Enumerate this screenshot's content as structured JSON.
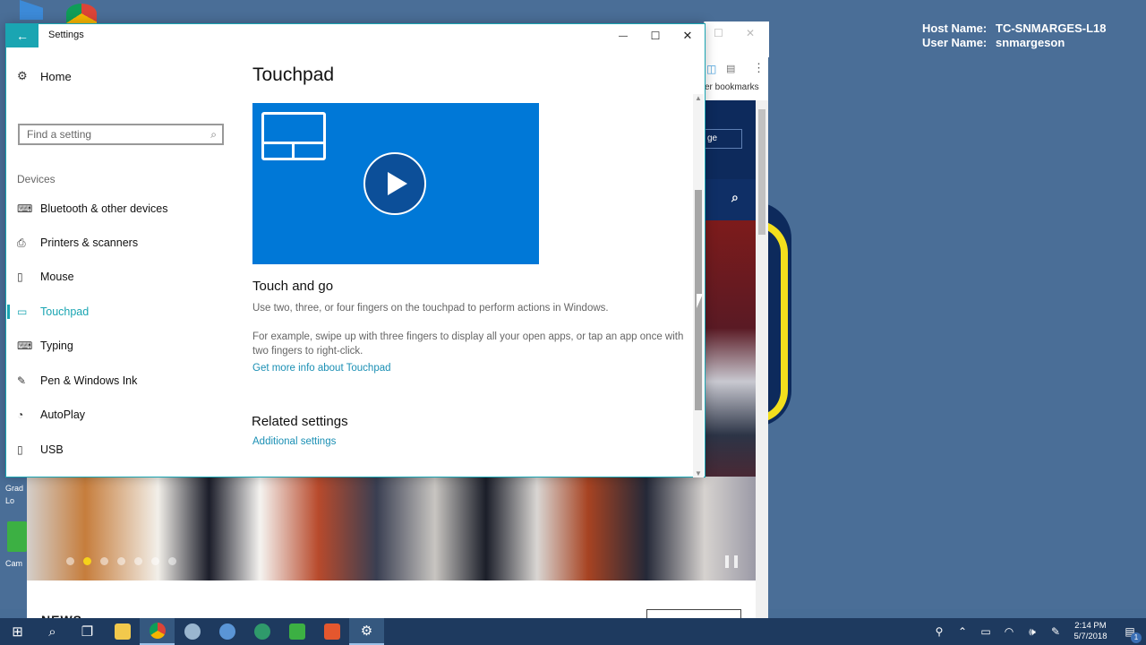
{
  "bginfo": {
    "host_key": "Host Name:",
    "host_value": "TC-SNMARGES-L18",
    "user_key": "User Name:",
    "user_value": "snmargeson"
  },
  "browser": {
    "bookmarks_text": "er bookmarks",
    "nav_button_text": "ge"
  },
  "desktop": {
    "icon_label_1": "Grad",
    "icon_label_2": "Lo",
    "icon_label_3": "Cam"
  },
  "below": {
    "news": "NEWS"
  },
  "settings": {
    "window_title": "Settings",
    "back_glyph": "←",
    "minimize_glyph": "—",
    "maximize_glyph": "☐",
    "close_glyph": "✕",
    "home_label": "Home",
    "search_placeholder": "Find a setting",
    "section_label": "Devices",
    "nav_items": [
      {
        "label": "Bluetooth & other devices",
        "icon": "keyboard-icon"
      },
      {
        "label": "Printers & scanners",
        "icon": "printer-icon"
      },
      {
        "label": "Mouse",
        "icon": "mouse-icon"
      },
      {
        "label": "Touchpad",
        "icon": "touchpad-icon",
        "active": true
      },
      {
        "label": "Typing",
        "icon": "keyboard-icon"
      },
      {
        "label": "Pen & Windows Ink",
        "icon": "pen-icon"
      },
      {
        "label": "AutoPlay",
        "icon": "autoplay-icon"
      },
      {
        "label": "USB",
        "icon": "usb-icon"
      }
    ],
    "page_title": "Touchpad",
    "subheading": "Touch and go",
    "para1": "Use two, three, or four fingers on the touchpad to perform actions in Windows.",
    "para2": "For example, swipe up with three fingers to display all your open apps, or tap an app once with two fingers to right-click.",
    "link_more": "Get more info about Touchpad",
    "related_heading": "Related settings",
    "link_additional": "Additional settings"
  },
  "taskbar": {
    "time": "2:14 PM",
    "date": "5/7/2018",
    "notification_count": "1"
  },
  "colors": {
    "accent": "#1aa5b2",
    "video_bg": "#0078d7",
    "taskbar": "#1e3a5f",
    "desktop": "#4a6e97"
  }
}
